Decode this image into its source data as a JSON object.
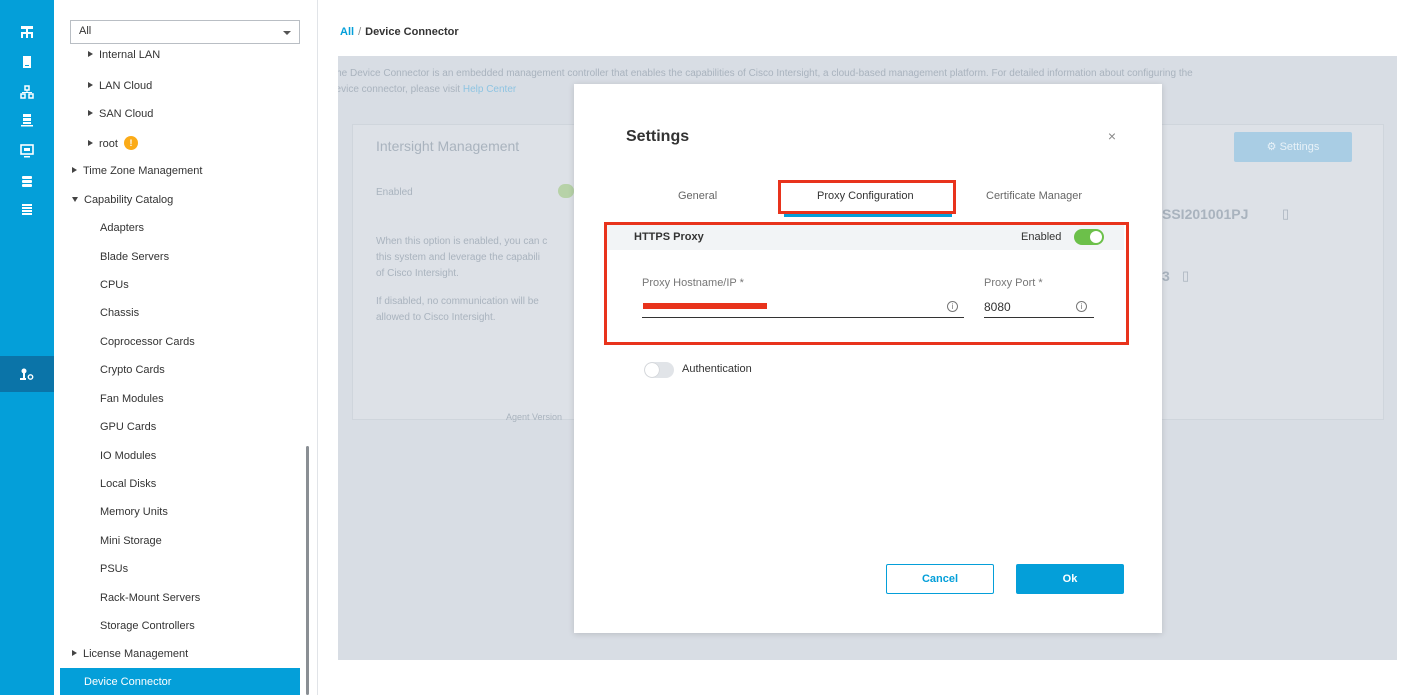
{
  "nav_rail": {
    "icons": [
      "network-tree-icon",
      "equipment-icon",
      "servers-icon",
      "chassis-stack-icon",
      "vm-monitor-icon",
      "storage-icon",
      "lan-list-icon",
      "admin-user-gear-icon"
    ],
    "active_index": 7
  },
  "tree": {
    "filter_value": "All",
    "items": [
      {
        "label": "Internal LAN",
        "expander": "collapsed",
        "indent": 1
      },
      {
        "label": "LAN Cloud",
        "expander": "collapsed",
        "indent": 1
      },
      {
        "label": "SAN Cloud",
        "expander": "collapsed",
        "indent": 1
      },
      {
        "label": "root",
        "expander": "collapsed",
        "indent": 1,
        "warning": true
      },
      {
        "label": "Time Zone Management",
        "expander": "collapsed",
        "indent": 0
      },
      {
        "label": "Capability Catalog",
        "expander": "expanded",
        "indent": 0
      },
      {
        "label": "Adapters",
        "indent": 2
      },
      {
        "label": "Blade Servers",
        "indent": 2
      },
      {
        "label": "CPUs",
        "indent": 2
      },
      {
        "label": "Chassis",
        "indent": 2
      },
      {
        "label": "Coprocessor Cards",
        "indent": 2
      },
      {
        "label": "Crypto Cards",
        "indent": 2
      },
      {
        "label": "Fan Modules",
        "indent": 2
      },
      {
        "label": "GPU Cards",
        "indent": 2
      },
      {
        "label": "IO Modules",
        "indent": 2
      },
      {
        "label": "Local Disks",
        "indent": 2
      },
      {
        "label": "Memory Units",
        "indent": 2
      },
      {
        "label": "Mini Storage",
        "indent": 2
      },
      {
        "label": "PSUs",
        "indent": 2
      },
      {
        "label": "Rack-Mount Servers",
        "indent": 2
      },
      {
        "label": "Storage Controllers",
        "indent": 2
      },
      {
        "label": "License Management",
        "expander": "collapsed",
        "indent": 0
      }
    ],
    "active_item": "Device Connector"
  },
  "breadcrumb": {
    "root": "All",
    "separator": "/",
    "current": "Device Connector"
  },
  "background": {
    "description_part1": "The Device Connector is an embedded management controller that enables the capabilities of Cisco Intersight, a cloud-based management platform. For detailed information about configuring the",
    "description_part2": "device connector, please visit",
    "help_link": "Help Center",
    "card_title": "Intersight Management",
    "enabled_label": "Enabled",
    "body_line1": "When this option is enabled, you can c",
    "body_line2": "this system and leverage the capabili",
    "body_line3": "of Cisco Intersight.",
    "body_line4": "If disabled, no communication will be",
    "body_line5": "allowed to Cisco Intersight.",
    "agent_version": "Agent Version",
    "settings_button": "Settings",
    "serial": "SSI201001PJ",
    "partial_digit": "3"
  },
  "modal": {
    "title": "Settings",
    "close": "×",
    "tabs": [
      "General",
      "Proxy Configuration",
      "Certificate Manager"
    ],
    "active_tab": 1,
    "https_proxy": {
      "title": "HTTPS Proxy",
      "enabled_label": "Enabled",
      "enabled": true,
      "hostname_label": "Proxy Hostname/IP *",
      "hostname_value": "",
      "port_label": "Proxy Port *",
      "port_value": "8080",
      "info_glyph": "i"
    },
    "authentication": {
      "label": "Authentication",
      "enabled": false
    },
    "buttons": {
      "cancel": "Cancel",
      "ok": "Ok"
    }
  },
  "colors": {
    "accent": "#049fd9",
    "highlight": "#e8331c",
    "toggle_on": "#6cc04a",
    "warning": "#fbab18"
  }
}
